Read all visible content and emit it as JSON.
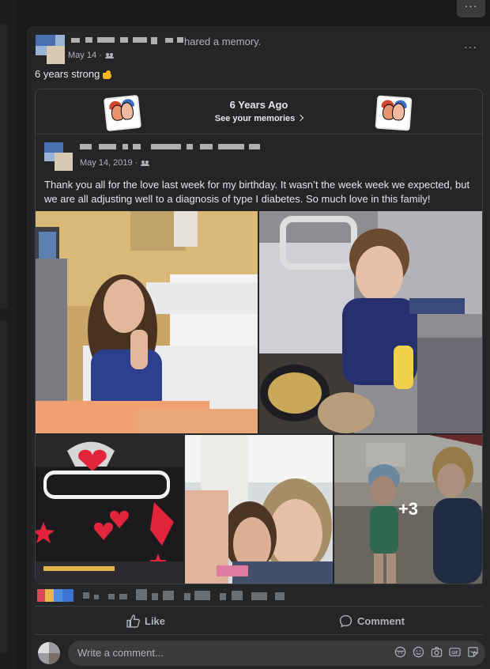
{
  "top_menu": {
    "icon": "more-dots-icon",
    "label": "···"
  },
  "post": {
    "author_redacted": true,
    "action_text": "hared a memory.",
    "date": "May 14",
    "audience_separator": "·",
    "audience_icon": "friends-icon",
    "more_label": "···",
    "text": "6 years strong",
    "emoji_icon": "flexed-biceps-icon"
  },
  "memory": {
    "title": "6 Years Ago",
    "subtitle": "See your memories",
    "sticker_left": "friends-sticker-icon",
    "sticker_right": "friends-sticker-icon",
    "original_date": "May 14, 2019",
    "original_separator": "·",
    "original_text": "Thank you all for the love last week for my birthday. It wasn’t the week week we expected, but we are all adjusting well to a diagnosis of type I diabetes. So much love in this family!",
    "photos": [
      {
        "name": "photo-hospital-thumbs-up"
      },
      {
        "name": "photo-hospital-banana"
      },
      {
        "name": "photo-gymnastics-poster"
      },
      {
        "name": "photo-selfie"
      },
      {
        "name": "photo-swim",
        "more_count": "+3"
      }
    ]
  },
  "actions": {
    "like": "Like",
    "comment": "Comment"
  },
  "comment_box": {
    "placeholder": "Write a comment...",
    "icons": [
      "avatar-sticker-icon",
      "emoji-icon",
      "camera-icon",
      "gif-icon",
      "sticker-icon"
    ]
  },
  "colors": {
    "background": "#18191a",
    "card": "#242526",
    "text": "#e4e6eb",
    "secondary_text": "#b0b3b8",
    "input": "#3a3b3c"
  }
}
